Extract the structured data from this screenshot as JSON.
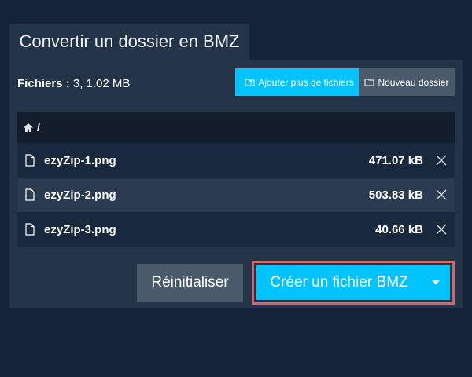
{
  "tab": {
    "title": "Convertir un dossier en BMZ"
  },
  "summary": {
    "label": "Fichiers :",
    "value": "3, 1.02 MB"
  },
  "toolbar": {
    "add_files_label": "Ajouter plus de fichiers",
    "new_folder_label": "Nouveau dossier"
  },
  "filelist": {
    "path": "/",
    "files": [
      {
        "name": "ezyZip-1.png",
        "size": "471.07 kB"
      },
      {
        "name": "ezyZip-2.png",
        "size": "503.83 kB"
      },
      {
        "name": "ezyZip-3.png",
        "size": "40.66 kB"
      }
    ]
  },
  "actions": {
    "reset_label": "Réinitialiser",
    "create_label": "Créer un fichier BMZ"
  },
  "colors": {
    "background": "#14233a",
    "panel": "#233448",
    "accent": "#00c3ff",
    "secondary": "#4a5a6b",
    "highlight_border": "#d5666a"
  },
  "icons": {
    "add_files": "folder-sync-icon",
    "new_folder": "folder-icon",
    "home": "home-icon",
    "file": "file-icon",
    "remove": "close-icon",
    "dropdown": "caret-down-icon"
  }
}
